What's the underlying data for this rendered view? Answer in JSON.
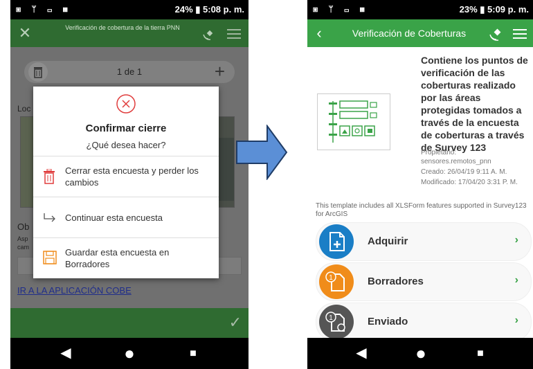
{
  "colors": {
    "green": "#3aa348",
    "dark_green": "#2f6b31",
    "danger": "#e03c3c",
    "blue": "#1a7ec6",
    "orange": "#f08c1a",
    "gray": "#555555"
  },
  "phone1": {
    "status": {
      "icons_left": "▣ ᛘ ▭ ▦",
      "right": "24% ▮ 5:08 p. m."
    },
    "header": {
      "title": "Verificación de cobertura de la tierra PNN",
      "close_icon": "close-icon",
      "menu_icon": "menu-icon"
    },
    "counter": {
      "text": "1 de 1"
    },
    "background_labels": {
      "loc": "Loc",
      "ob": "Ob",
      "asp": "Asp",
      "cam": "cam"
    },
    "link": "IR A LA APLICACIÓN COBE",
    "dialog": {
      "title": "Confirmar cierre",
      "subtitle": "¿Qué desea hacer?",
      "options": [
        {
          "icon": "trash-icon",
          "label": "Cerrar esta encuesta y perder los cambios"
        },
        {
          "icon": "arrow-right-icon",
          "label": "Continuar esta encuesta"
        },
        {
          "icon": "save-icon",
          "label": "Guardar esta encuesta en Borradores"
        }
      ]
    },
    "nav": {
      "back": "◀",
      "home": "●",
      "recent": "■"
    }
  },
  "phone2": {
    "status": {
      "icons_left": "▣ ᛘ ▭ ▦",
      "right": "23% ▮ 5:09 p. m."
    },
    "header": {
      "title": "Verificación de Coberturas",
      "back_icon": "back-icon",
      "menu_icon": "menu-icon"
    },
    "description": "Contiene los puntos de verificación de las coberturas realizado por las áreas protegidas tomados a través de la encuesta de coberturas a través de Survey 123",
    "owner_label": "Propietario:",
    "owner": "sensores.remotos_pnn",
    "created": "Creado: 26/04/19 9:11 A. M.",
    "modified": "Modificado: 17/04/20 3:31 P. M.",
    "template_text": "This template includes all XLSForm features supported in Survey123 for ArcGIS",
    "actions": [
      {
        "label": "Adquirir",
        "icon": "new-survey-icon"
      },
      {
        "label": "Borradores",
        "icon": "drafts-icon",
        "badge": "1"
      },
      {
        "label": "Enviado",
        "icon": "sent-icon",
        "badge": "1"
      }
    ],
    "nav": {
      "back": "◀",
      "home": "●",
      "recent": "■"
    }
  }
}
